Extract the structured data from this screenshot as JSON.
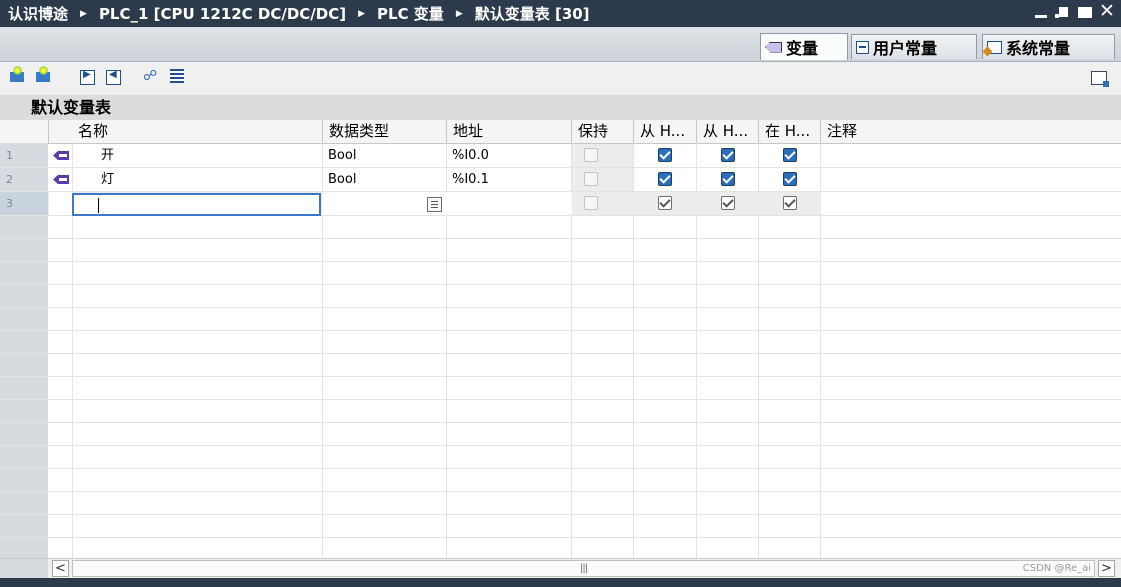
{
  "title_bar": {
    "breadcrumbs": [
      "认识博途",
      "PLC_1 [CPU 1212C DC/DC/DC]",
      "PLC 变量",
      "默认变量表 [30]"
    ]
  },
  "tabs": [
    {
      "label": "变量",
      "icon": "tag-icon",
      "active": true
    },
    {
      "label": "用户常量",
      "icon": "constant-icon",
      "active": false
    },
    {
      "label": "系统常量",
      "icon": "system-constant-icon",
      "active": false
    }
  ],
  "toolbar": {
    "icons": [
      "add-row-icon",
      "insert-row-icon",
      "export-icon",
      "import-icon",
      "monitor-icon",
      "show-table-icon",
      "panel-toggle-icon"
    ]
  },
  "table": {
    "title": "默认变量表",
    "columns": [
      "名称",
      "数据类型",
      "地址",
      "保持",
      "从 H...",
      "从 H...",
      "在 H...",
      "注释"
    ],
    "rows": [
      {
        "num": "1",
        "name": "开",
        "type": "Bool",
        "address": "%I0.0",
        "retain": false,
        "hmi_access": true,
        "hmi_visible": true,
        "hmi_engineering": true
      },
      {
        "num": "2",
        "name": "灯",
        "type": "Bool",
        "address": "%I0.1",
        "retain": false,
        "hmi_access": true,
        "hmi_visible": true,
        "hmi_engineering": true
      },
      {
        "num": "3",
        "name": "",
        "type": "",
        "address": "",
        "retain": false,
        "hmi_access": true,
        "hmi_visible": true,
        "hmi_engineering": true
      }
    ]
  },
  "watermark": "CSDN @Re_ai",
  "colors": {
    "title_bar": "#2c3a4c",
    "checkbox_checked": "#2a6fb8",
    "edit_border": "#3b78c9"
  }
}
